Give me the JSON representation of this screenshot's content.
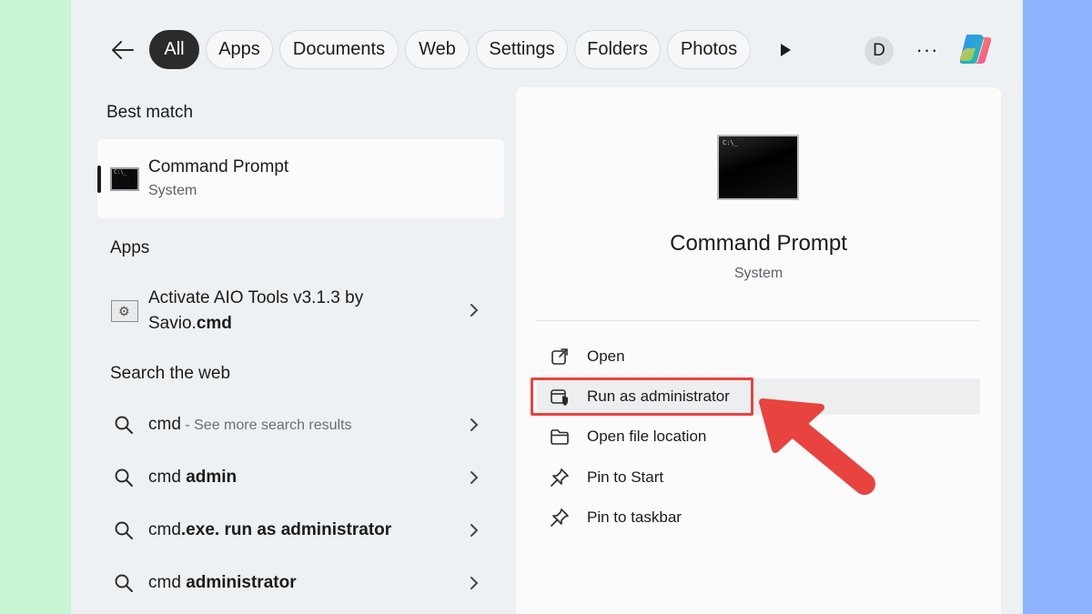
{
  "filters": {
    "tabs": [
      {
        "label": "All",
        "active": true
      },
      {
        "label": "Apps"
      },
      {
        "label": "Documents"
      },
      {
        "label": "Web"
      },
      {
        "label": "Settings"
      },
      {
        "label": "Folders"
      },
      {
        "label": "Photos"
      }
    ],
    "avatar_initial": "D",
    "more_label": "···"
  },
  "best_match": {
    "heading": "Best match",
    "title": "Command Prompt",
    "subtitle": "System"
  },
  "apps": {
    "heading": "Apps",
    "items": [
      {
        "title_line1": "Activate AIO Tools v3.1.3 by",
        "title_line2_normal": "Savio.",
        "title_line2_bold": "cmd"
      }
    ]
  },
  "web": {
    "heading": "Search the web",
    "items": [
      {
        "normal": "cmd",
        "bold": "",
        "muted": " - See more search results"
      },
      {
        "normal": "cmd ",
        "bold": "admin",
        "muted": ""
      },
      {
        "normal": "cmd",
        "bold": ".exe. run as administrator",
        "muted": ""
      },
      {
        "normal": "cmd ",
        "bold": "administrator",
        "muted": ""
      }
    ]
  },
  "detail": {
    "title": "Command Prompt",
    "subtitle": "System",
    "icon_text": "C:\\_",
    "actions": [
      {
        "label": "Open",
        "icon": "open-external-icon"
      },
      {
        "label": "Run as administrator",
        "icon": "shield-admin-icon",
        "highlighted": true
      },
      {
        "label": "Open file location",
        "icon": "folder-icon"
      },
      {
        "label": "Pin to Start",
        "icon": "pin-icon"
      },
      {
        "label": "Pin to taskbar",
        "icon": "pin-icon"
      }
    ]
  },
  "colors": {
    "annotation_red": "#e8433f",
    "active_tab": "#2b2b2b"
  }
}
